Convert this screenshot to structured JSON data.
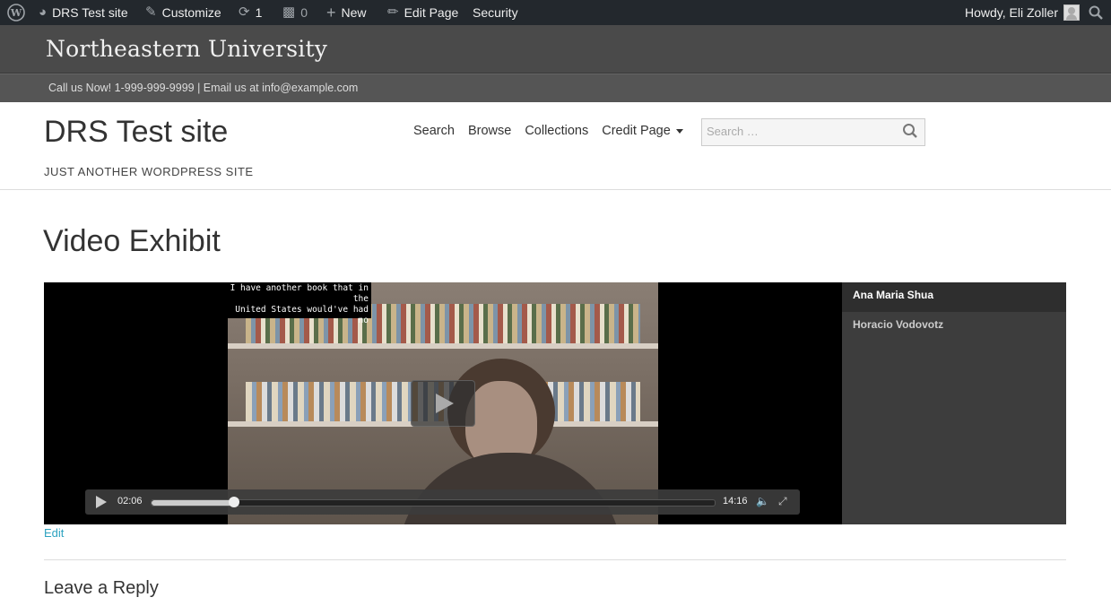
{
  "adminbar": {
    "site_name": "DRS Test site",
    "customize": "Customize",
    "updates_count": "1",
    "comments_count": "0",
    "new_label": "New",
    "edit_page": "Edit Page",
    "security": "Security",
    "howdy": "Howdy, Eli Zoller"
  },
  "university": {
    "name": "Northeastern University",
    "contact": "Call us Now! 1-999-999-9999 | Email us at info@example.com"
  },
  "site": {
    "title": "DRS Test site",
    "description": "JUST ANOTHER WORDPRESS SITE"
  },
  "nav": {
    "items": [
      "Search",
      "Browse",
      "Collections",
      "Credit Page"
    ]
  },
  "search": {
    "placeholder": "Search …"
  },
  "page": {
    "title": "Video Exhibit"
  },
  "player": {
    "caption_line1": "I have another book that in the",
    "caption_line2": "United States would've had no",
    "current_time": "02:06",
    "duration": "14:16",
    "progress": 0.147
  },
  "playlist": {
    "items": [
      "Ana Maria Shua",
      "Horacio Vodovotz"
    ],
    "active_index": 0
  },
  "footer": {
    "edit": "Edit",
    "reply_heading": "Leave a Reply"
  },
  "colors": {
    "link": "#2ea3c0",
    "adminbar": "#23282d"
  }
}
